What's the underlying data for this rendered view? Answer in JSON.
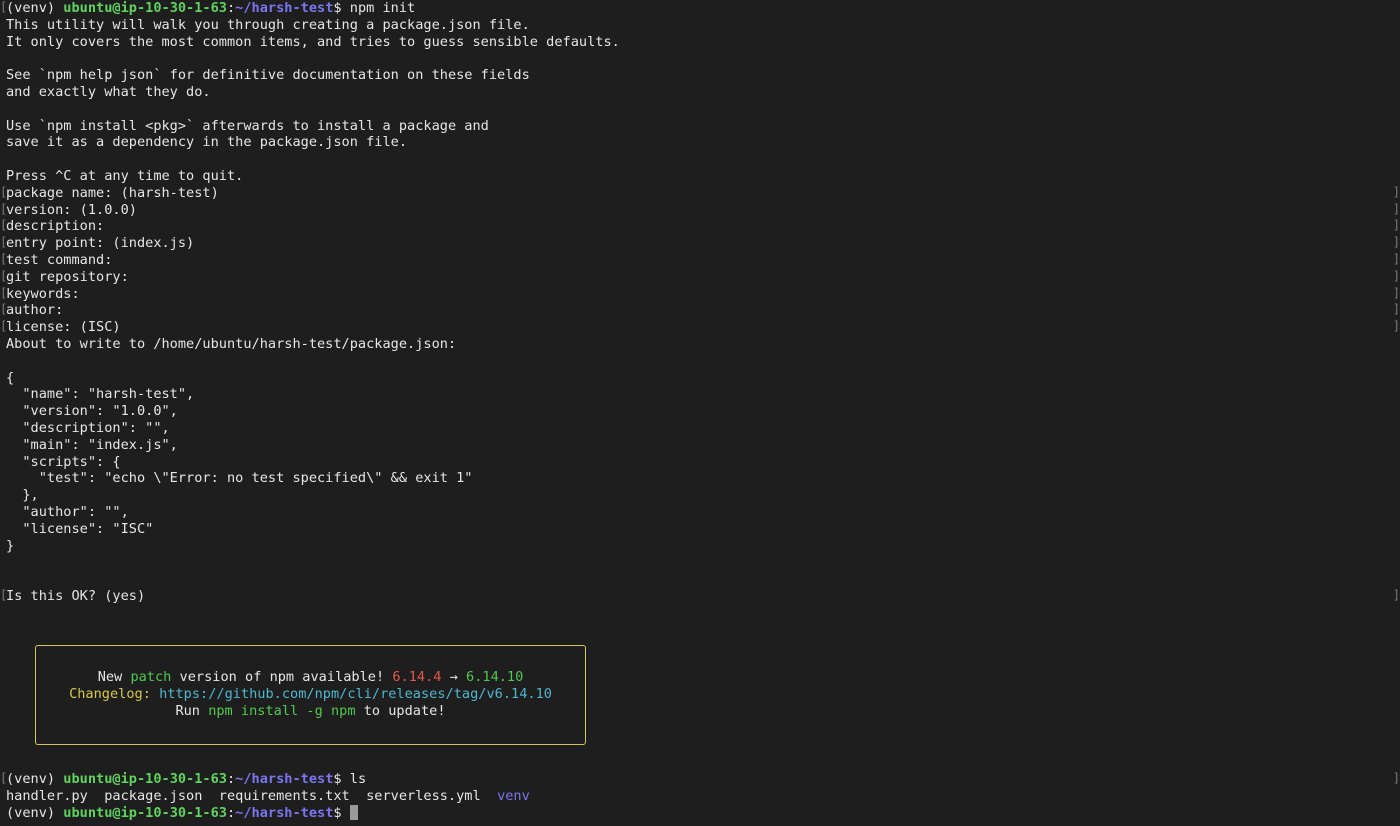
{
  "colors": {
    "background": "#1e1e1e",
    "text": "#e6e6e6",
    "user_host": "#5fd35f",
    "path": "#7b76f0",
    "box_border": "#d8c84a",
    "old_version": "#e35a4a",
    "new_version": "#4fc94f",
    "url": "#4fb8cf"
  },
  "prompt1": {
    "venv": "(venv) ",
    "user_host": "ubuntu@ip-10-30-1-63",
    "colon": ":",
    "path": "~/harsh-test",
    "symbol": "$ ",
    "command": "npm init"
  },
  "intro_lines": [
    "This utility will walk you through creating a package.json file.",
    "It only covers the most common items, and tries to guess sensible defaults.",
    "",
    "See `npm help json` for definitive documentation on these fields",
    "and exactly what they do.",
    "",
    "Use `npm install <pkg>` afterwards to install a package and",
    "save it as a dependency in the package.json file.",
    "",
    "Press ^C at any time to quit."
  ],
  "questions": [
    "package name: (harsh-test)",
    "version: (1.0.0)",
    "description:",
    "entry point: (index.js)",
    "test command:",
    "git repository:",
    "keywords:",
    "author:",
    "license: (ISC)"
  ],
  "about_to_write": "About to write to /home/ubuntu/harsh-test/package.json:",
  "json_lines": [
    "{",
    "  \"name\": \"harsh-test\",",
    "  \"version\": \"1.0.0\",",
    "  \"description\": \"\",",
    "  \"main\": \"index.js\",",
    "  \"scripts\": {",
    "    \"test\": \"echo \\\"Error: no test specified\\\" && exit 1\"",
    "  },",
    "  \"author\": \"\",",
    "  \"license\": \"ISC\"",
    "}"
  ],
  "confirm": "Is this OK? (yes)",
  "update_box": {
    "line1_a": "New ",
    "line1_patch": "patch",
    "line1_b": " version of npm available! ",
    "old_version": "6.14.4",
    "arrow": " → ",
    "new_version": "6.14.10",
    "changelog_label": "Changelog: ",
    "changelog_url": "https://github.com/npm/cli/releases/tag/v6.14.10",
    "run_a": "Run ",
    "run_cmd": "npm install -g npm",
    "run_b": " to update!"
  },
  "prompt2": {
    "venv": "(venv) ",
    "user_host": "ubuntu@ip-10-30-1-63",
    "colon": ":",
    "path": "~/harsh-test",
    "symbol": "$ ",
    "command": "ls"
  },
  "ls_output": {
    "files": "handler.py  package.json  requirements.txt  serverless.yml  ",
    "dir": "venv"
  },
  "prompt3": {
    "venv": "(venv) ",
    "user_host": "ubuntu@ip-10-30-1-63",
    "colon": ":",
    "path": "~/harsh-test",
    "symbol": "$ ",
    "command": ""
  }
}
